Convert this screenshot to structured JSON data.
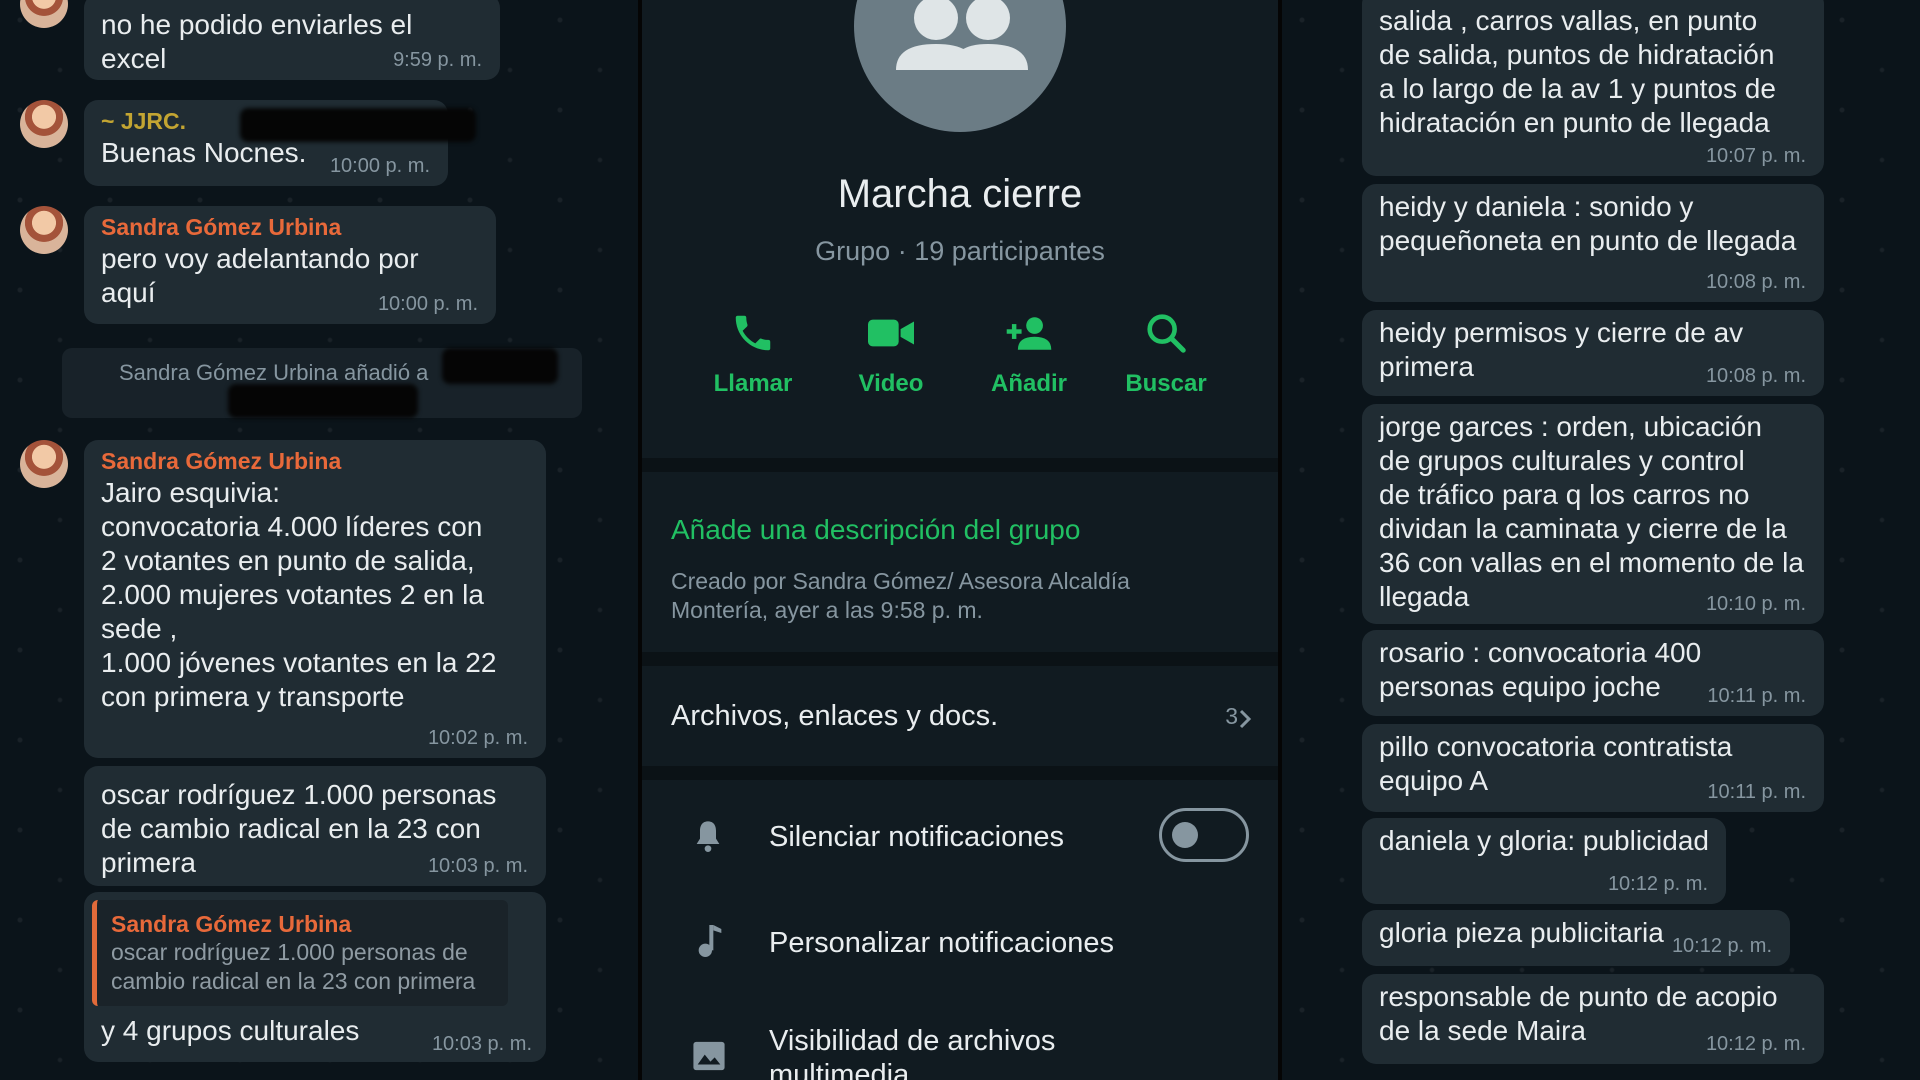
{
  "left_chat": {
    "messages": [
      {
        "text": "no he podido enviarles el excel",
        "time": "9:59 p. m."
      },
      {
        "sender": "~ JJRC.",
        "sender_color": "#c3a532",
        "text": "Buenas Nocnes.",
        "time": "10:00 p. m."
      },
      {
        "sender": "Sandra Gómez Urbina",
        "sender_color": "#e8693a",
        "text": "pero voy adelantando por aquí",
        "time": "10:00 p. m."
      },
      {
        "text": "Jairo esquivia:\nconvocatoria 4.000 líderes con\n2 votantes en punto de salida,\n2.000 mujeres votantes 2 en la\nsede ,\n1.000 jóvenes votantes en la 22\ncon primera y transporte",
        "sender": "Sandra Gómez Urbina",
        "time": "10:02 p. m."
      },
      {
        "text": "oscar rodríguez 1.000 personas\nde cambio radical en la 23 con\nprimera",
        "time": "10:03 p. m."
      },
      {
        "text": "y 4 grupos culturales",
        "time": "10:03 p. m."
      }
    ],
    "system_message": "Sandra Gómez Urbina añadió a",
    "quote": {
      "name": "Sandra Gómez Urbina",
      "text": "oscar rodríguez 1.000 personas de cambio radical en la 23 con primera"
    }
  },
  "group_info": {
    "title": "Marcha cierre",
    "subtitle": "Grupo · 19 participantes",
    "actions": [
      {
        "label": "Llamar",
        "icon": "phone-icon"
      },
      {
        "label": "Video",
        "icon": "video-icon"
      },
      {
        "label": "Añadir",
        "icon": "add-person-icon"
      },
      {
        "label": "Buscar",
        "icon": "search-icon"
      }
    ],
    "add_description": "Añade una descripción del grupo",
    "created": "Creado por Sandra Gómez/ Asesora Alcaldía Montería, ayer a las 9:58 p. m.",
    "files_label": "Archivos, enlaces y docs.",
    "files_count": "3",
    "mute_label": "Silenciar notificaciones",
    "mute_enabled": false,
    "custom_label": "Personalizar notificaciones",
    "media_label": "Visibilidad de archivos multimedia",
    "accent_color": "#21c063"
  },
  "right_chat": {
    "messages": [
      {
        "text": "salida , carros vallas, en punto\nde salida, puntos de hidratación\na lo largo de la av 1 y puntos de\nhidratación en punto de llegada",
        "time": "10:07 p. m."
      },
      {
        "text": "heidy y daniela : sonido y\npequeñoneta en punto de llegada",
        "time": "10:08 p. m."
      },
      {
        "text": "heidy permisos y cierre de av\nprimera",
        "time": "10:08 p. m."
      },
      {
        "text": "jorge garces : orden, ubicación\nde grupos culturales y control\nde tráfico para q los carros no\ndividan la caminata y cierre de la\n36 con vallas en el momento de la\nllegada",
        "time": "10:10 p. m."
      },
      {
        "text": "rosario : convocatoria 400\npersonas equipo joche",
        "time": "10:11 p. m."
      },
      {
        "text": "pillo convocatoria contratista\nequipo A",
        "time": "10:11 p. m."
      },
      {
        "text": "daniela y gloria: publicidad",
        "time": "10:12 p. m."
      },
      {
        "text": "gloria pieza publicitaria",
        "time": "10:12 p. m."
      },
      {
        "text": "responsable de punto de acopio\nde la sede Maira",
        "time": "10:12 p. m."
      }
    ]
  }
}
